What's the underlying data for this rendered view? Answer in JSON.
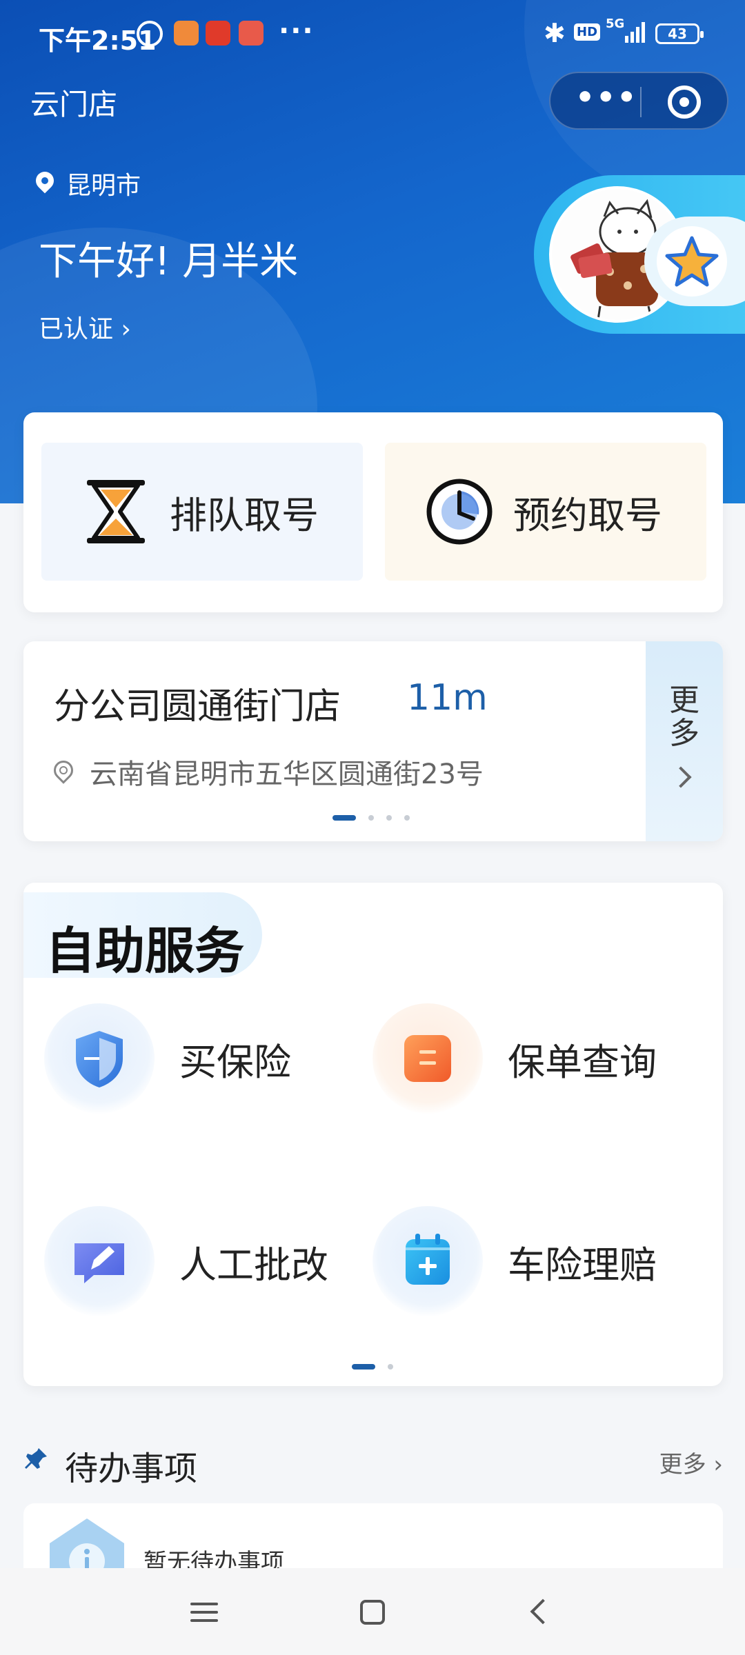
{
  "status_bar": {
    "time": "下午2:51",
    "more_dots": "···",
    "network": "5G",
    "hd_badge": "HD",
    "battery": "43"
  },
  "header": {
    "app_title": "云门店",
    "capsule_menu": "•••",
    "location": "昆明市",
    "greeting": "下午好! 月半米",
    "verified": "已认证 ›"
  },
  "queue": {
    "queue_label": "排队取号",
    "appointment_label": "预约取号"
  },
  "store": {
    "name": "分公司圆通街门店",
    "distance": "11m",
    "address": "云南省昆明市五华区圆通街23号",
    "more_label": "更多",
    "pager_count": 4,
    "pager_active": 0
  },
  "self_service": {
    "title": "自助服务",
    "items": [
      {
        "label": "买保险",
        "icon": "shield-icon"
      },
      {
        "label": "保单查询",
        "icon": "document-icon"
      },
      {
        "label": "人工批改",
        "icon": "edit-icon"
      },
      {
        "label": "车险理赔",
        "icon": "calendar-plus-icon"
      }
    ],
    "pager_count": 2,
    "pager_active": 0
  },
  "todo": {
    "title": "待办事项",
    "more": "更多 ›",
    "empty_text": "暂无待办事项"
  },
  "colors": {
    "brand_blue": "#1466cc",
    "accent_link": "#1d5fa8",
    "orange": "#f07b3a"
  }
}
